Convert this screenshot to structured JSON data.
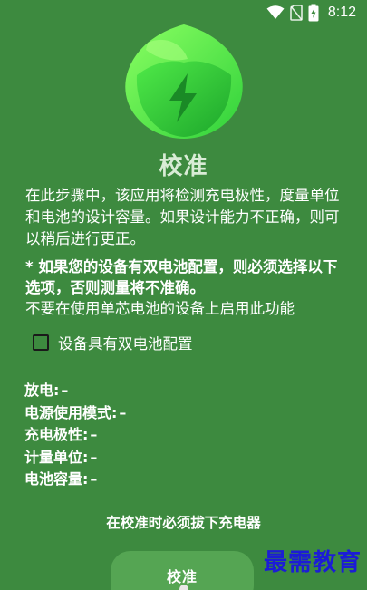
{
  "status_bar": {
    "time": "8:12",
    "icons": [
      "wifi-icon",
      "no-sim-icon",
      "battery-charging-icon"
    ]
  },
  "logo": {
    "icon": "leaf-lightning-icon",
    "colors": {
      "light": "#7dff5e",
      "mid": "#34d83a",
      "dark": "#1eae2c"
    }
  },
  "title": "校准",
  "description": "在此步骤中，该应用将检测充电极性，度量单位和电池的设计容量。如果设计能力不正确，则可以稍后进行更正。",
  "warning": {
    "line1": "* 如果您的设备有双电池配置，则必须选择以下选项，否则测量将不准确。",
    "line2": "不要在使用单芯电池的设备上启用此功能"
  },
  "dual_battery": {
    "label": "设备具有双电池配置",
    "checked": false
  },
  "info": {
    "discharge": {
      "label": "放电:",
      "value": "–"
    },
    "power_mode": {
      "label": "电源使用模式:",
      "value": "–"
    },
    "polarity": {
      "label": "充电极性:",
      "value": "–"
    },
    "unit": {
      "label": "计量单位:",
      "value": "–"
    },
    "capacity": {
      "label": "电池容量:",
      "value": "–"
    }
  },
  "notice": "在校准时必须拔下充电器",
  "calibrate_button": "校准",
  "watermark": "最需教育",
  "colors": {
    "background": "#3d8a3f",
    "button": "#55a553",
    "title": "#d9ecd6",
    "watermark": "#1c1cd6"
  }
}
